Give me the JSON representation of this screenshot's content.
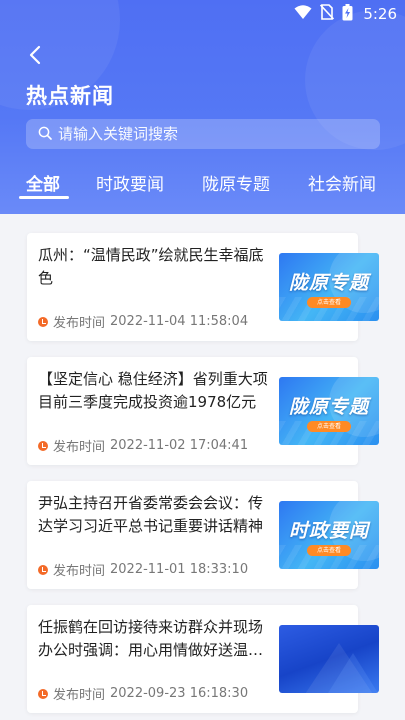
{
  "status_bar": {
    "time": "5:26",
    "icons": [
      "wifi-icon",
      "no-sim-icon",
      "battery-charging-icon"
    ]
  },
  "header": {
    "back_icon": "chevron-left-icon",
    "title": "热点新闻"
  },
  "search": {
    "placeholder": "请输入关键词搜索",
    "icon": "search-icon"
  },
  "tabs": [
    {
      "label": "全部",
      "active": true
    },
    {
      "label": "时政要闻",
      "active": false
    },
    {
      "label": "陇原专题",
      "active": false
    },
    {
      "label": "社会新闻",
      "active": false
    }
  ],
  "news": [
    {
      "title": "瓜州：“温情民政”绘就民生幸福底色",
      "meta_label": "发布时间",
      "time": "2022-11-04 11:58:04",
      "thumb_text": "陇原专题",
      "thumb_button": "点击查看"
    },
    {
      "title": "【坚定信心 稳住经济】省列重大项目前三季度完成投资逾1978亿元",
      "meta_label": "发布时间",
      "time": "2022-11-02 17:04:41",
      "thumb_text": "陇原专题",
      "thumb_button": "点击查看"
    },
    {
      "title": "尹弘主持召开省委常委会会议：传达学习习近平总书记重要讲话精神",
      "meta_label": "发布时间",
      "time": "2022-11-01 18:33:10",
      "thumb_text": "时政要闻",
      "thumb_button": "点击查看"
    },
    {
      "title": "任振鹤在回访接待来访群众并现场办公时强调：用心用情做好送温暖工作",
      "meta_label": "发布时间",
      "time": "2022-09-23 16:18:30",
      "thumb_text": "",
      "thumb_button": ""
    }
  ],
  "colors": {
    "header_blue": "#4f6ff3",
    "clock_orange": "#f36a28",
    "thumb_button_orange": "#ff8a24"
  }
}
